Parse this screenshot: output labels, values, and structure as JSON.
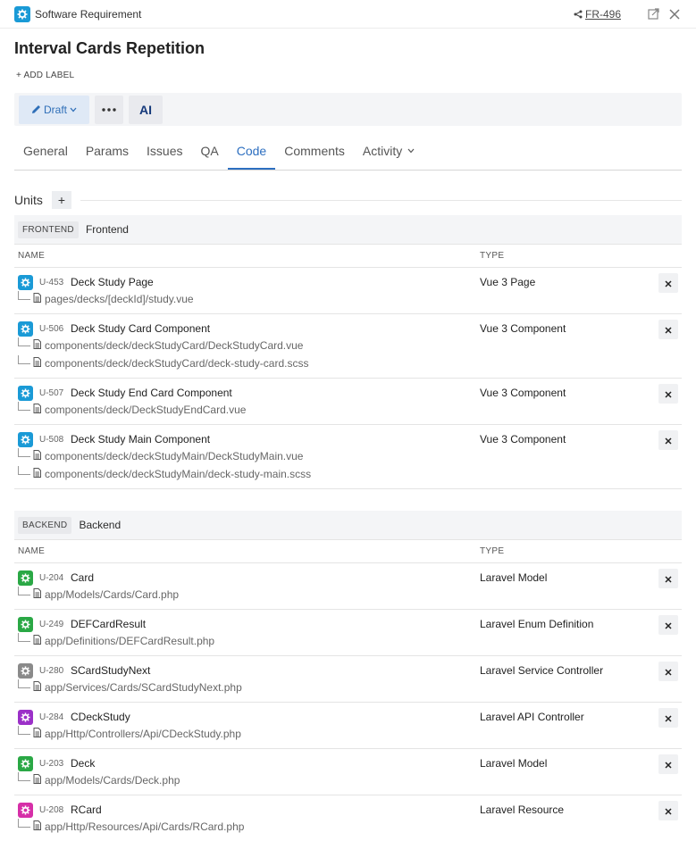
{
  "header": {
    "type_label": "Software Requirement",
    "issue_key": "FR-496"
  },
  "title": "Interval Cards Repetition",
  "add_label": "+ ADD LABEL",
  "toolbar": {
    "status_label": "Draft",
    "ai_label": "AI"
  },
  "tabs": [
    "General",
    "Params",
    "Issues",
    "QA",
    "Code",
    "Comments",
    "Activity"
  ],
  "active_tab": "Code",
  "units": {
    "label": "Units",
    "add_symbol": "+"
  },
  "columns": {
    "name": "NAME",
    "type": "TYPE"
  },
  "colors": {
    "blue": "#1a9ad6",
    "green": "#2aa845",
    "grey": "#8a8a8a",
    "purple": "#9b30c8",
    "magenta": "#d62fa8"
  },
  "groups": [
    {
      "badge": "FRONTEND",
      "name": "Frontend",
      "units": [
        {
          "key": "U-453",
          "name": "Deck Study Page",
          "type": "Vue 3 Page",
          "color": "blue",
          "files": [
            "pages/decks/[deckId]/study.vue"
          ]
        },
        {
          "key": "U-506",
          "name": "Deck Study Card Component",
          "type": "Vue 3 Component",
          "color": "blue",
          "files": [
            "components/deck/deckStudyCard/DeckStudyCard.vue",
            "components/deck/deckStudyCard/deck-study-card.scss"
          ]
        },
        {
          "key": "U-507",
          "name": "Deck Study End Card Component",
          "type": "Vue 3 Component",
          "color": "blue",
          "files": [
            "components/deck/DeckStudyEndCard.vue"
          ]
        },
        {
          "key": "U-508",
          "name": "Deck Study Main Component",
          "type": "Vue 3 Component",
          "color": "blue",
          "files": [
            "components/deck/deckStudyMain/DeckStudyMain.vue",
            "components/deck/deckStudyMain/deck-study-main.scss"
          ]
        }
      ]
    },
    {
      "badge": "BACKEND",
      "name": "Backend",
      "units": [
        {
          "key": "U-204",
          "name": "Card",
          "type": "Laravel Model",
          "color": "green",
          "files": [
            "app/Models/Cards/Card.php"
          ]
        },
        {
          "key": "U-249",
          "name": "DEFCardResult",
          "type": "Laravel Enum Definition",
          "color": "green",
          "files": [
            "app/Definitions/DEFCardResult.php"
          ]
        },
        {
          "key": "U-280",
          "name": "SCardStudyNext",
          "type": "Laravel Service Controller",
          "color": "grey",
          "files": [
            "app/Services/Cards/SCardStudyNext.php"
          ]
        },
        {
          "key": "U-284",
          "name": "CDeckStudy",
          "type": "Laravel API Controller",
          "color": "purple",
          "files": [
            "app/Http/Controllers/Api/CDeckStudy.php"
          ]
        },
        {
          "key": "U-203",
          "name": "Deck",
          "type": "Laravel Model",
          "color": "green",
          "files": [
            "app/Models/Cards/Deck.php"
          ]
        },
        {
          "key": "U-208",
          "name": "RCard",
          "type": "Laravel Resource",
          "color": "magenta",
          "files": [
            "app/Http/Resources/Api/Cards/RCard.php"
          ]
        }
      ]
    }
  ]
}
